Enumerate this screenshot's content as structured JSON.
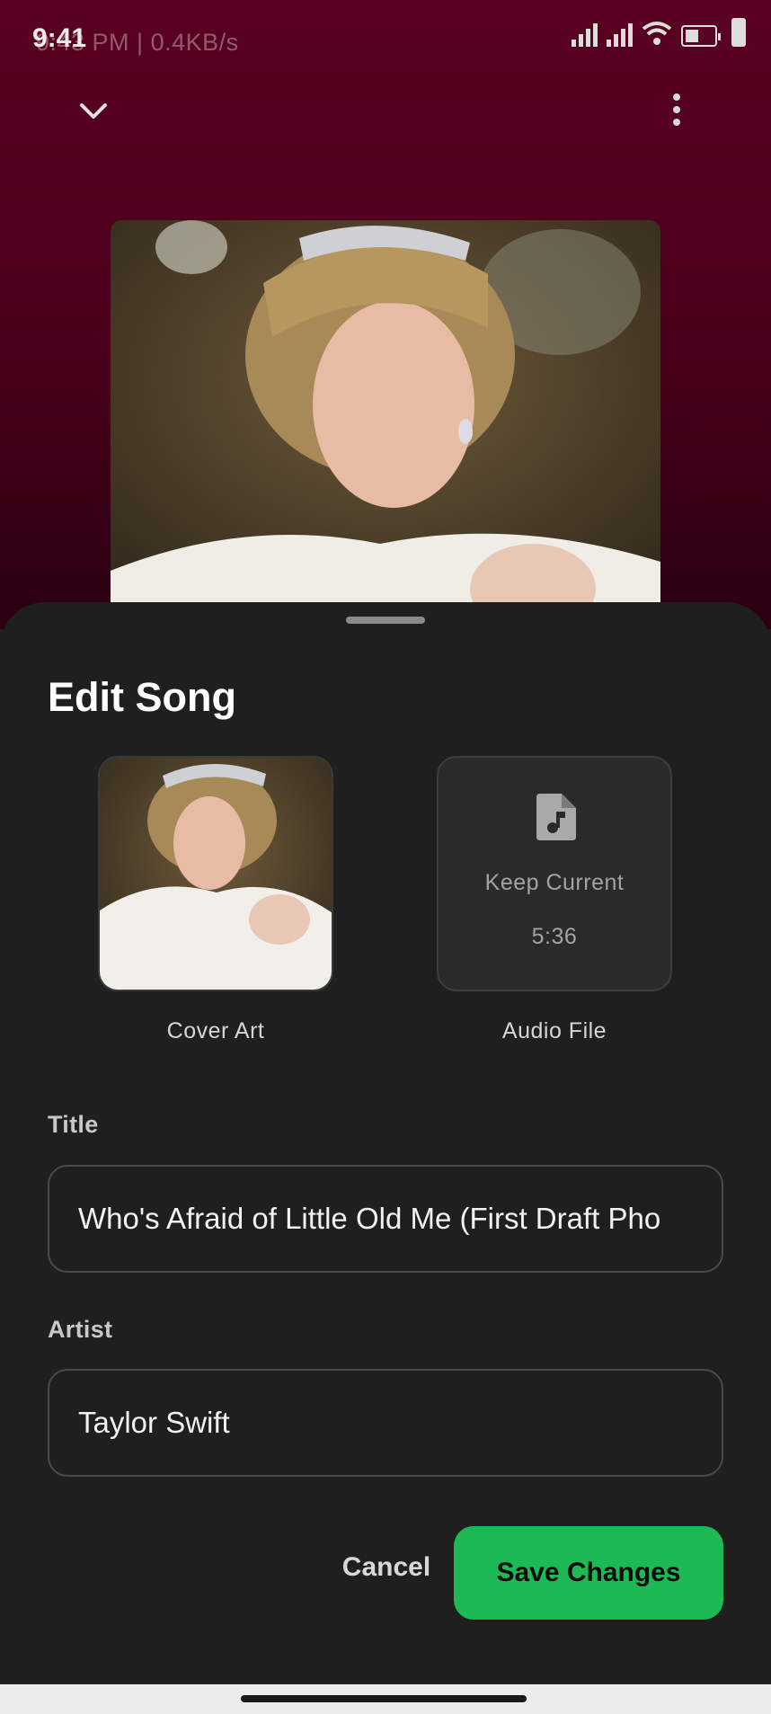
{
  "status_bar": {
    "time": "9:41",
    "ghost_text": "9:43 PM | 0.4KB/s"
  },
  "player": {
    "collapse_icon": "chevron-down-icon",
    "more_icon": "more-vertical-icon"
  },
  "sheet": {
    "title": "Edit Song",
    "cover_art": {
      "caption": "Cover Art"
    },
    "audio_file": {
      "icon": "music-file-icon",
      "status": "Keep Current",
      "duration": "5:36",
      "caption": "Audio File"
    },
    "title_field": {
      "label": "Title",
      "value": "Who's Afraid of Little Old Me (First Draft Pho"
    },
    "artist_field": {
      "label": "Artist",
      "value": "Taylor Swift"
    },
    "cancel_label": "Cancel",
    "save_label": "Save Changes"
  },
  "colors": {
    "accent": "#1db954",
    "sheet_bg": "#1f1f1f",
    "player_bg": "#5a0020"
  }
}
